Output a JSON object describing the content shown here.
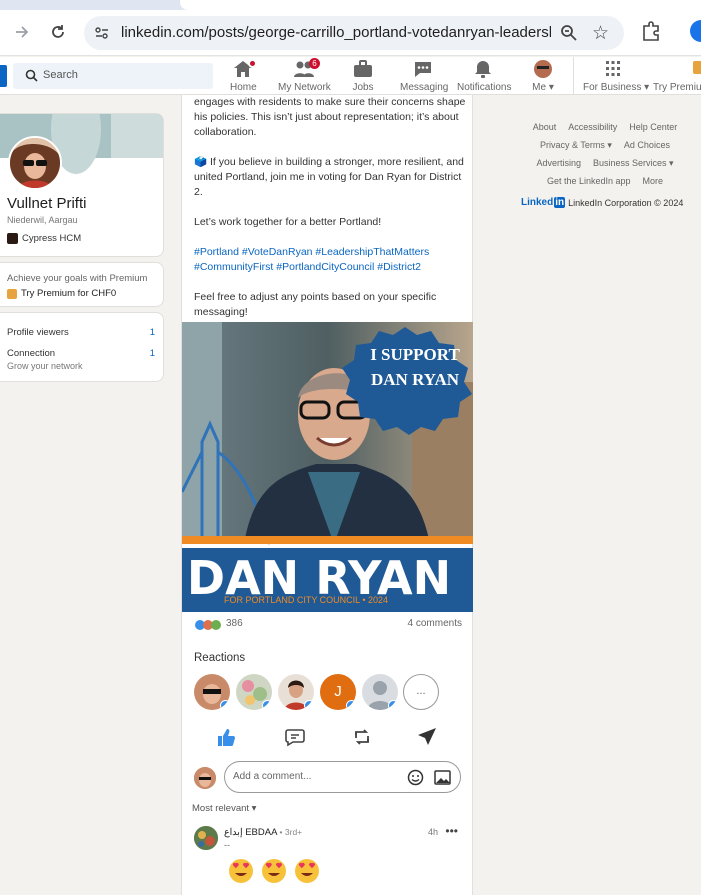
{
  "browser": {
    "url": "linkedin.com/posts/george-carrillo_portland-votedanryan-leadersh..."
  },
  "header": {
    "search_placeholder": "Search",
    "nav": [
      {
        "label": "Home",
        "icon": "home-icon"
      },
      {
        "label": "My Network",
        "icon": "network-icon",
        "badge": "6"
      },
      {
        "label": "Jobs",
        "icon": "briefcase-icon"
      },
      {
        "label": "Messaging",
        "icon": "messaging-icon"
      },
      {
        "label": "Notifications",
        "icon": "bell-icon"
      },
      {
        "label": "Me",
        "icon": "avatar-icon"
      },
      {
        "label": "For Business",
        "icon": "grid-icon"
      },
      {
        "label": "Try Premium",
        "icon": "premium-icon"
      }
    ]
  },
  "profile": {
    "name": "Vullnet Prifti",
    "location": "Niederwil, Aargau",
    "company": "Cypress HCM"
  },
  "premium": {
    "line1": "Achieve your goals with Premium",
    "cta": "Try Premium for CHF0"
  },
  "stats": {
    "viewers_label": "Profile viewers",
    "viewers_value": "1",
    "connections_label": "Connection",
    "connections_value": "1",
    "grow": "Grow your network"
  },
  "post": {
    "para1": "engages with residents to make sure their concerns shape his policies. This isn’t just about representation; it’s about collaboration.",
    "para2": "🗳️ If you believe in building a stronger, more resilient, and united Portland, join me in voting for Dan Ryan for District 2.",
    "para3": "Let’s work together for a better Portland!",
    "hashtags": "#Portland #VoteDanRyan #LeadershipThatMatters #CommunityFirst #PortlandCityCouncil #District2",
    "para4": "Feel free to adjust any points based on your specific messaging!",
    "image": {
      "badge_line1": "I SUPPORT",
      "badge_line2": "DAN RYAN",
      "banner_name": "DAN RYAN",
      "banner_sub": "FOR PORTLAND CITY COUNCIL  •  2024"
    },
    "reaction_count": "386",
    "comments_count": "4 comments",
    "reactions_label": "Reactions",
    "reactor_initial": "J",
    "more": "...",
    "comment_placeholder": "Add a comment...",
    "sort_label": "Most relevant"
  },
  "comment": {
    "author": "إبداع EBDAA",
    "degree": "• 3rd+",
    "time": "4h",
    "subtitle": "--",
    "dots": "•••"
  },
  "footer": {
    "row1": [
      "About",
      "Accessibility",
      "Help Center"
    ],
    "row2": [
      "Privacy & Terms",
      "Ad Choices"
    ],
    "row3": [
      "Advertising",
      "Business Services"
    ],
    "row4": [
      "Get the LinkedIn app",
      "More"
    ],
    "corp": "LinkedIn Corporation © 2024",
    "wordmark": "Linked",
    "wordmark_in": "in"
  },
  "colors": {
    "linkedin_blue": "#0a66c2",
    "poster_blue": "#1f5a96",
    "poster_orange": "#f08a22",
    "badge_red": "#cb112d"
  }
}
